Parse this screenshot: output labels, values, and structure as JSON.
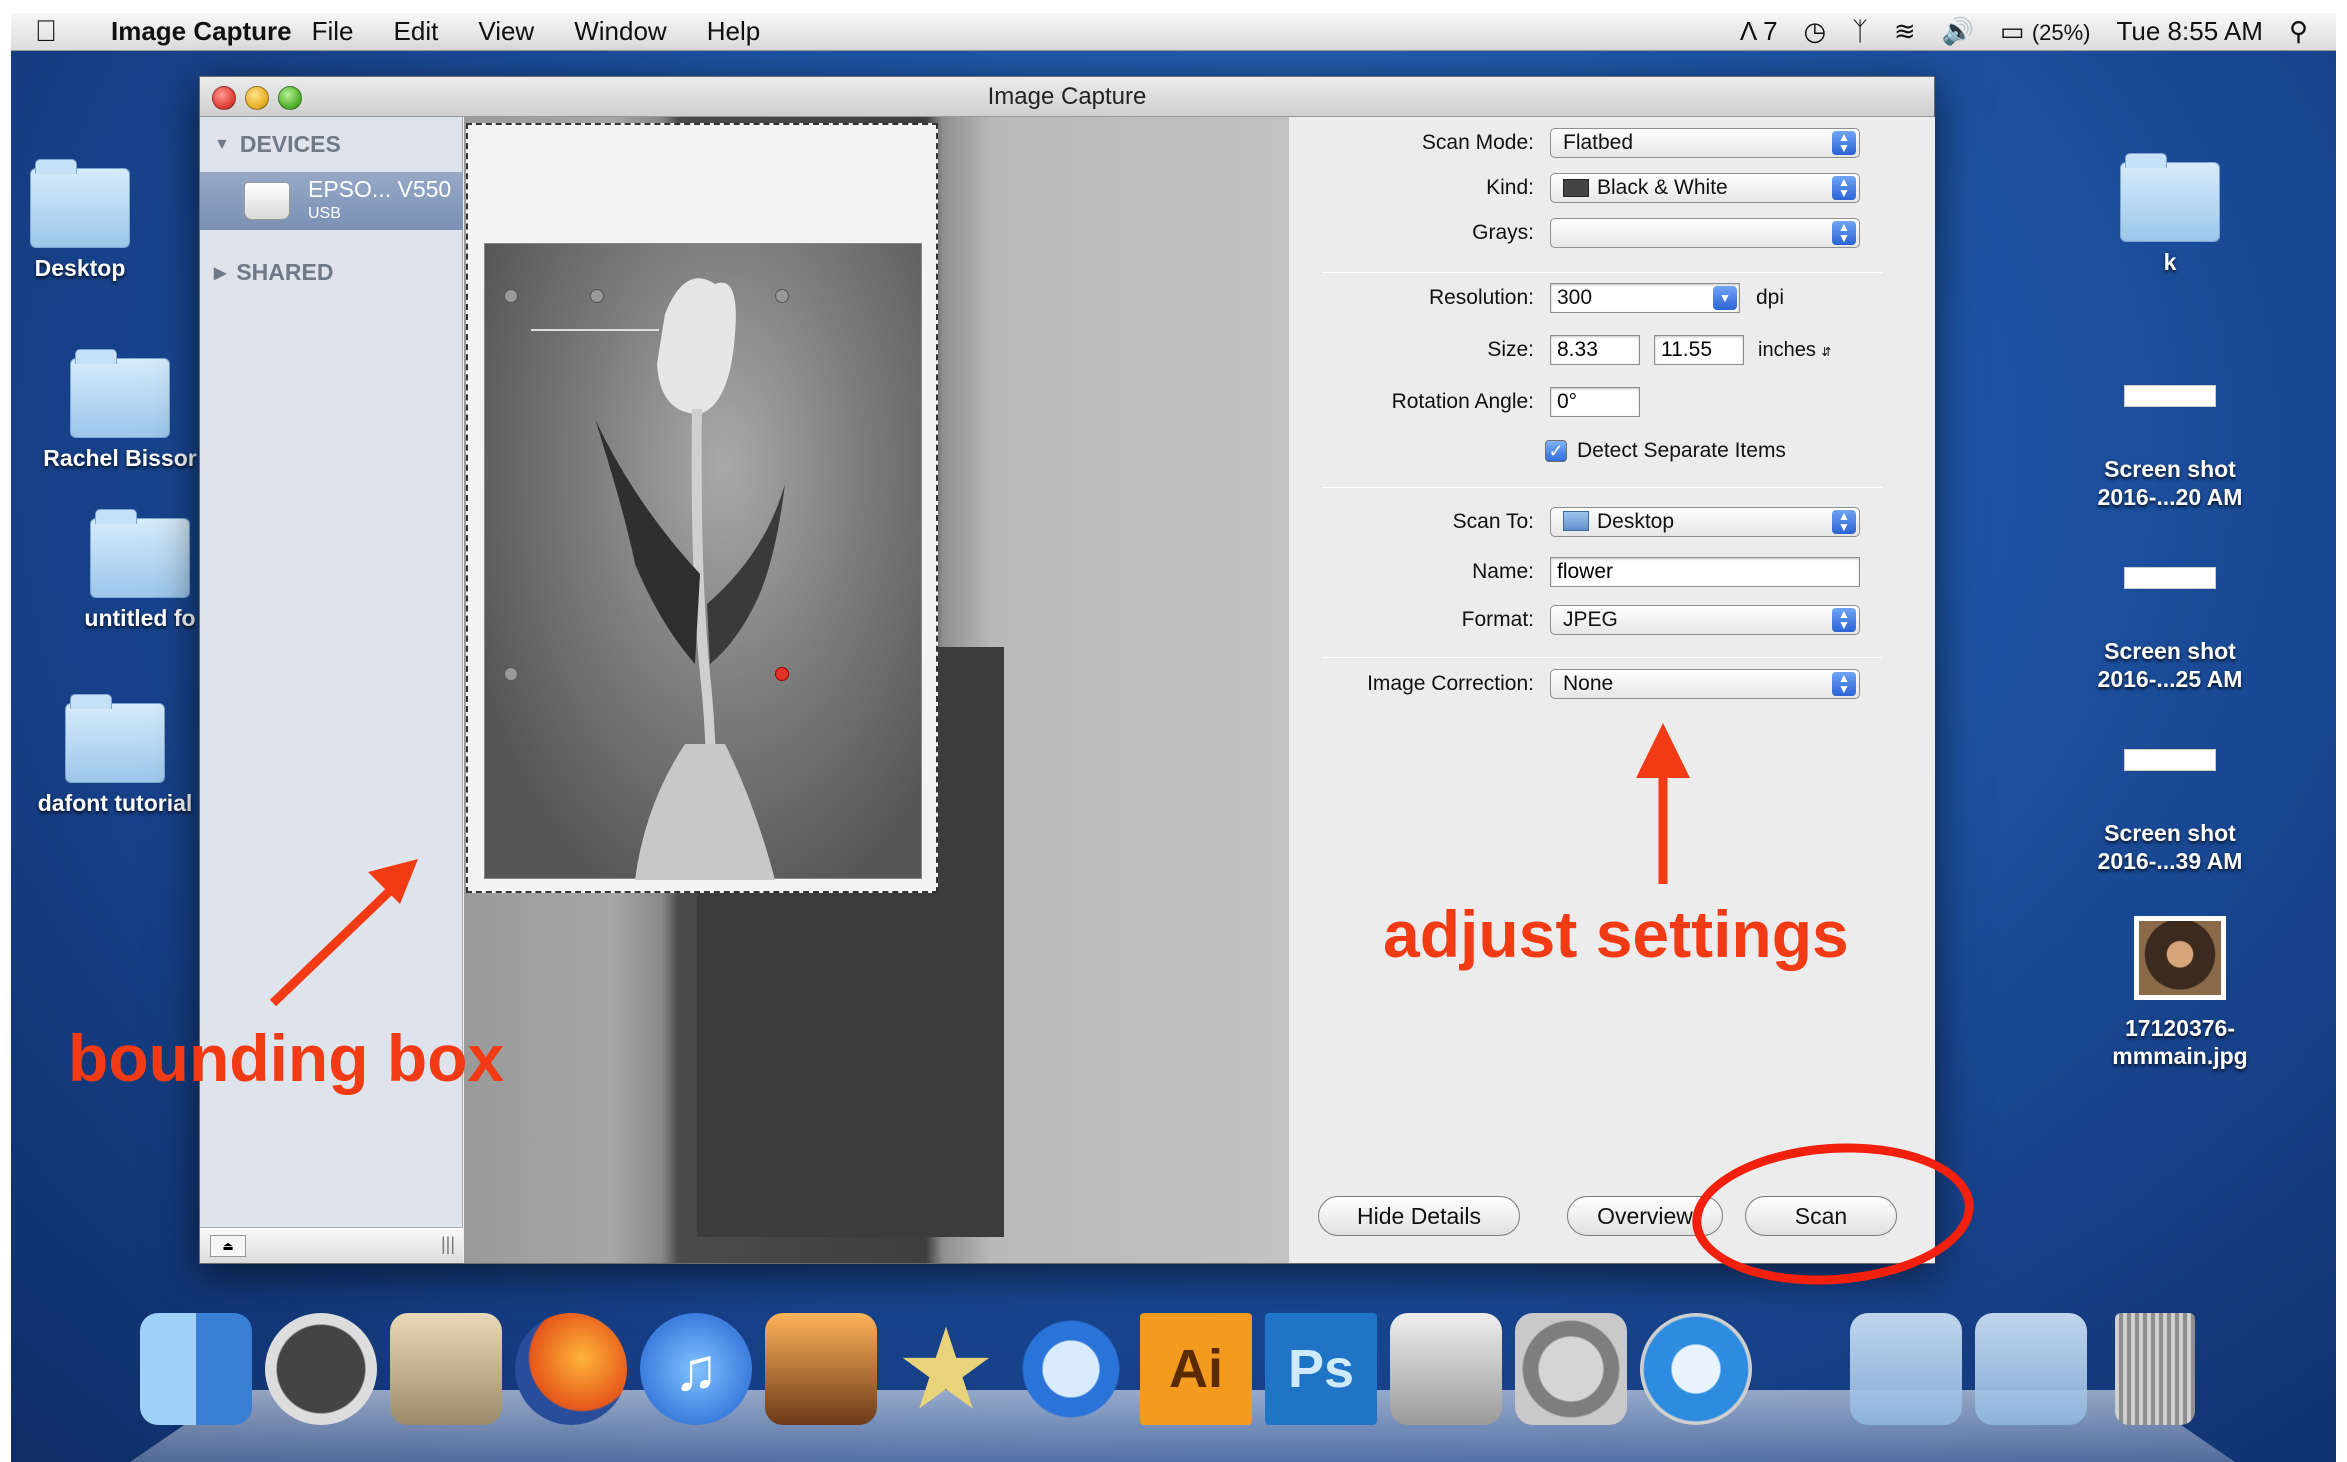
{
  "menubar": {
    "apple": "",
    "app_name": "Image Capture",
    "items": [
      "File",
      "Edit",
      "View",
      "Window",
      "Help"
    ],
    "status": {
      "adobe": "7",
      "battery": "(25%)",
      "clock": "Tue 8:55 AM"
    }
  },
  "desktop_left": [
    {
      "label": "Desktop"
    },
    {
      "label": "Rachel Bissor"
    },
    {
      "label": "untitled fo"
    },
    {
      "label": "dafont tutorial"
    }
  ],
  "desktop_right": {
    "folder_k": "k",
    "shots": [
      {
        "line1": "Screen shot",
        "line2": "2016-...20 AM"
      },
      {
        "line1": "Screen shot",
        "line2": "2016-...25 AM"
      },
      {
        "line1": "Screen shot",
        "line2": "2016-...39 AM"
      }
    ],
    "photo": {
      "line1": "17120376-",
      "line2": "mmmain.jpg"
    }
  },
  "window": {
    "title": "Image Capture"
  },
  "sidebar": {
    "devices_header": "DEVICES",
    "device_name": "EPSO... V550",
    "device_sub": "USB",
    "shared_header": "SHARED"
  },
  "settings": {
    "scan_mode_label": "Scan Mode:",
    "scan_mode": "Flatbed",
    "kind_label": "Kind:",
    "kind": "Black & White",
    "grays_label": "Grays:",
    "grays": "",
    "resolution_label": "Resolution:",
    "resolution": "300",
    "resolution_unit": "dpi",
    "size_label": "Size:",
    "size_w": "8.33",
    "size_h": "11.55",
    "size_unit": "inches",
    "rotation_label": "Rotation Angle:",
    "rotation": "0°",
    "detect_label": "Detect Separate Items",
    "detect_checked": true,
    "scan_to_label": "Scan To:",
    "scan_to": "Desktop",
    "name_label": "Name:",
    "name": "flower",
    "format_label": "Format:",
    "format": "JPEG",
    "correction_label": "Image Correction:",
    "correction": "None"
  },
  "buttons": {
    "hide_details": "Hide Details",
    "overview": "Overview",
    "scan": "Scan"
  },
  "annotations": {
    "bounding_box": "bounding box",
    "adjust_settings": "adjust settings"
  },
  "dock": {
    "items": [
      "finder-icon",
      "dashboard-icon",
      "iphoto-icon",
      "firefox-icon",
      "itunes-icon",
      "image-capture-dock-icon",
      "imovie-icon",
      "quicktime-icon",
      "illustrator-icon",
      "photoshop-icon",
      "camera-icon",
      "system-preferences-icon",
      "safari-icon",
      "applications-stack-icon",
      "documents-stack-icon",
      "trash-icon"
    ],
    "illustrator_text": "Ai",
    "photoshop_text": "Ps"
  },
  "colors": {
    "annotation_red": "#f23b14",
    "popup_blue": "#2b63d4",
    "sidebar_selected": "#7a90b4"
  }
}
